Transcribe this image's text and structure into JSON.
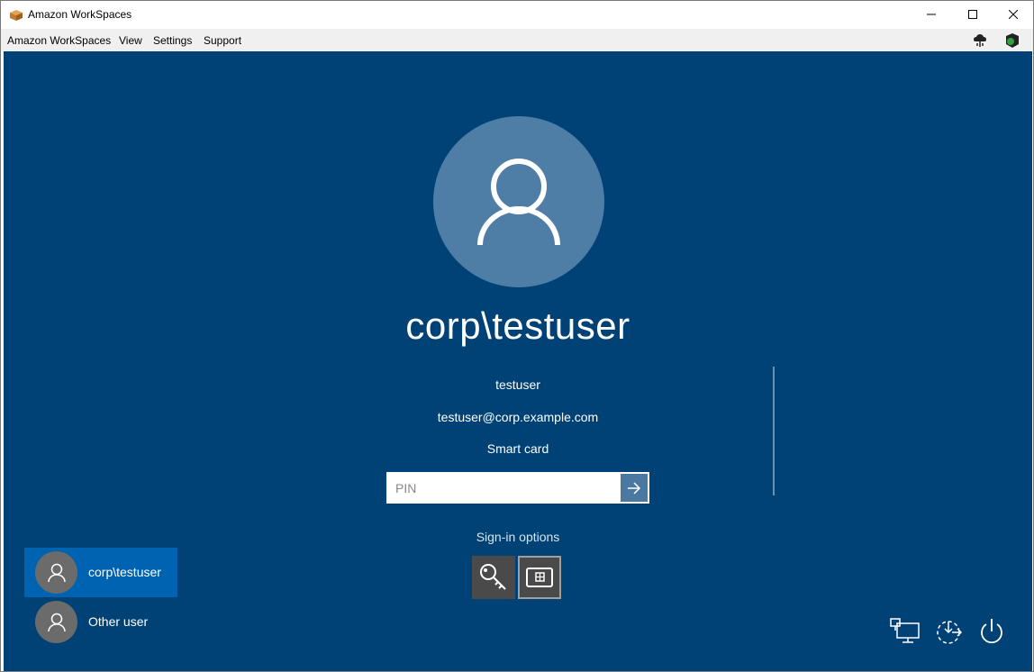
{
  "window": {
    "title": "Amazon WorkSpaces"
  },
  "menu": {
    "items": [
      {
        "label": "Amazon WorkSpaces"
      },
      {
        "label": "View"
      },
      {
        "label": "Settings"
      },
      {
        "label": "Support"
      }
    ],
    "icons": [
      "network-health-icon",
      "connection-status-icon"
    ]
  },
  "login": {
    "display_name": "corp\\testuser",
    "lines": [
      "testuser",
      "testuser@corp.example.com",
      "Smart card"
    ],
    "pin_placeholder": "PIN",
    "pin_value": "",
    "signin_options_label": "Sign-in options",
    "options": [
      "key-icon",
      "smart-card-icon"
    ]
  },
  "users": [
    {
      "label": "corp\\testuser",
      "selected": true
    },
    {
      "label": "Other user",
      "selected": false
    }
  ],
  "bottom_icons": [
    "network-icon",
    "ease-of-access-icon",
    "power-icon"
  ],
  "colors": {
    "background": "#004275",
    "avatar": "#4e7ea5",
    "selected_tile": "#0063b1"
  }
}
